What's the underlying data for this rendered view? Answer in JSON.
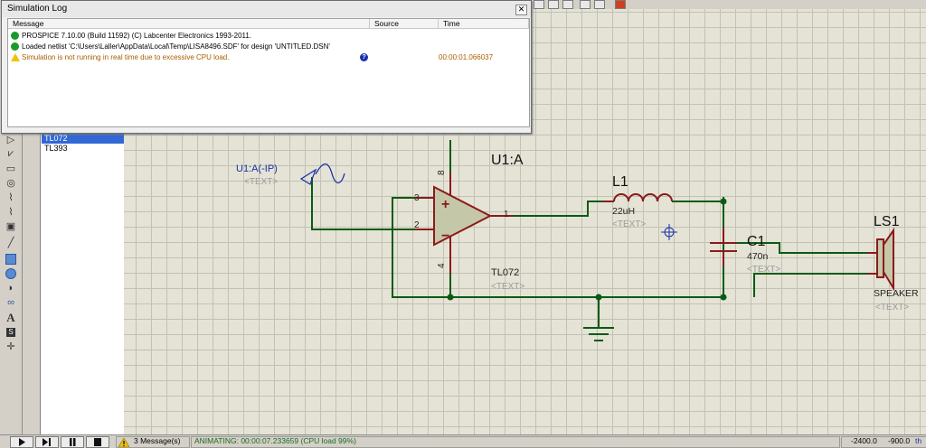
{
  "sim_log": {
    "title": "Simulation Log",
    "close_icon": "close-icon",
    "columns": [
      "Message",
      "Source",
      "Time"
    ],
    "rows": [
      {
        "type": "info",
        "icon": "info-icon",
        "message": "PROSPICE 7.10.00 (Build 11592) (C) Labcenter Electronics 1993-2011.",
        "time": ""
      },
      {
        "type": "info",
        "icon": "info-icon",
        "message": "Loaded netlist 'C:\\Users\\Laller\\AppData\\Local\\Temp\\LISA8496.SDF' for design 'UNTITLED.DSN'",
        "time": ""
      },
      {
        "type": "warning",
        "icon": "warning-icon",
        "message": "Simulation is not running in real time due to excessive CPU load.",
        "time": "00:00:01.066037"
      }
    ],
    "colors": {
      "info": "#1a9a2c",
      "warning": "#a85e00"
    }
  },
  "component_list": {
    "items": [
      "TL072",
      "TL393"
    ],
    "selected": "TL072"
  },
  "schematic": {
    "op_amp": {
      "ref": "U1:A",
      "part": "TL072",
      "text_placeholder": "<TEXT>",
      "pins": [
        "3",
        "2",
        "1",
        "8",
        "4"
      ],
      "plus_sign": "+",
      "minus_sign": "−"
    },
    "generator": {
      "ref": "U1:A(-IP)",
      "text_placeholder": "<TEXT>"
    },
    "inductor": {
      "ref": "L1",
      "value": "22uH",
      "text_placeholder": "<TEXT>"
    },
    "capacitor": {
      "ref": "C1",
      "value": "470n",
      "text_placeholder": "<TEXT>"
    },
    "speaker": {
      "ref": "LS1",
      "value": "SPEAKER",
      "text_placeholder": "<TEXT>"
    },
    "colors": {
      "wire": "#0b5a14",
      "component": "#8b1a1a",
      "label_blue": "#1a2fa8",
      "label_gray": "#9a9a9a",
      "terminal": "#b88a2e"
    }
  },
  "statusbar": {
    "messages": "3 Message(s)",
    "animating": "ANIMATING: 00:00:07.233659 (CPU load 99%)",
    "coord_x": "-2400.0",
    "coord_y": "-900.0",
    "units": "th"
  },
  "toolbar_icons": [
    "pointer-icon",
    "component-icon",
    "junction-icon",
    "wire-label-icon",
    "text-script-icon",
    "bus-icon",
    "subcircuit-icon",
    "terminal-icon",
    "device-pin-icon",
    "graph-icon",
    "tape-icon",
    "generator-icon",
    "voltage-probe-icon",
    "current-probe-icon",
    "virtual-instrument-icon",
    "line-icon",
    "box-icon",
    "circle-icon",
    "arc-icon",
    "path-icon",
    "text-icon",
    "symbol-icon",
    "marker-icon"
  ]
}
